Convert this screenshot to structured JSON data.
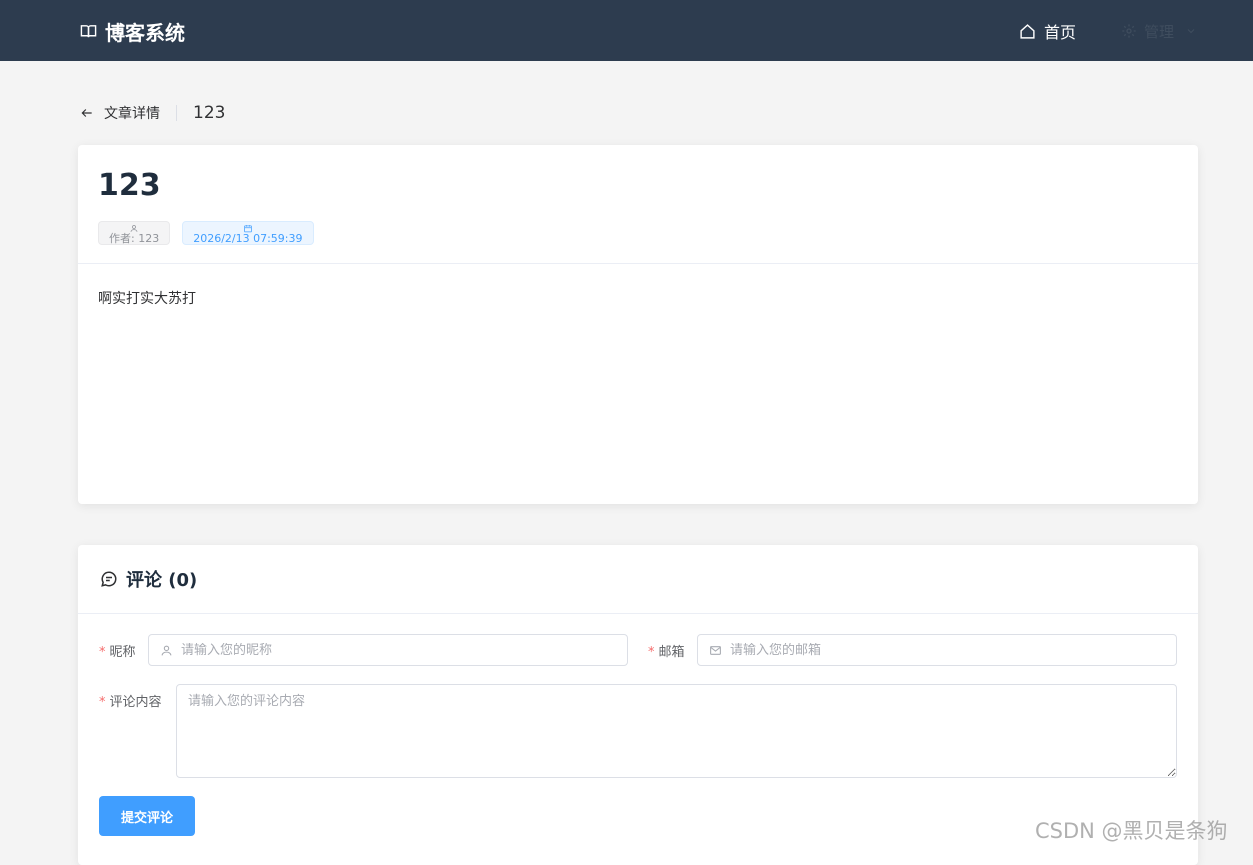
{
  "navbar": {
    "brand": "博客系统",
    "home": "首页",
    "manage": "管理"
  },
  "page_header": {
    "back_label": "文章详情",
    "content": "123"
  },
  "article": {
    "title": "123",
    "author": "作者: 123",
    "date": "2026/2/13 07:59:39",
    "body": "啊实打实大苏打"
  },
  "comments": {
    "title": "评论 (0)",
    "nickname_label": "昵称",
    "nickname_placeholder": "请输入您的昵称",
    "email_label": "邮箱",
    "email_placeholder": "请输入您的邮箱",
    "content_label": "评论内容",
    "content_placeholder": "请输入您的评论内容",
    "submit_label": "提交评论"
  },
  "watermark": "CSDN @黑贝是条狗",
  "colors": {
    "navbar_bg": "#2d3c4f",
    "primary": "#409eff",
    "required": "#f56c6c"
  }
}
